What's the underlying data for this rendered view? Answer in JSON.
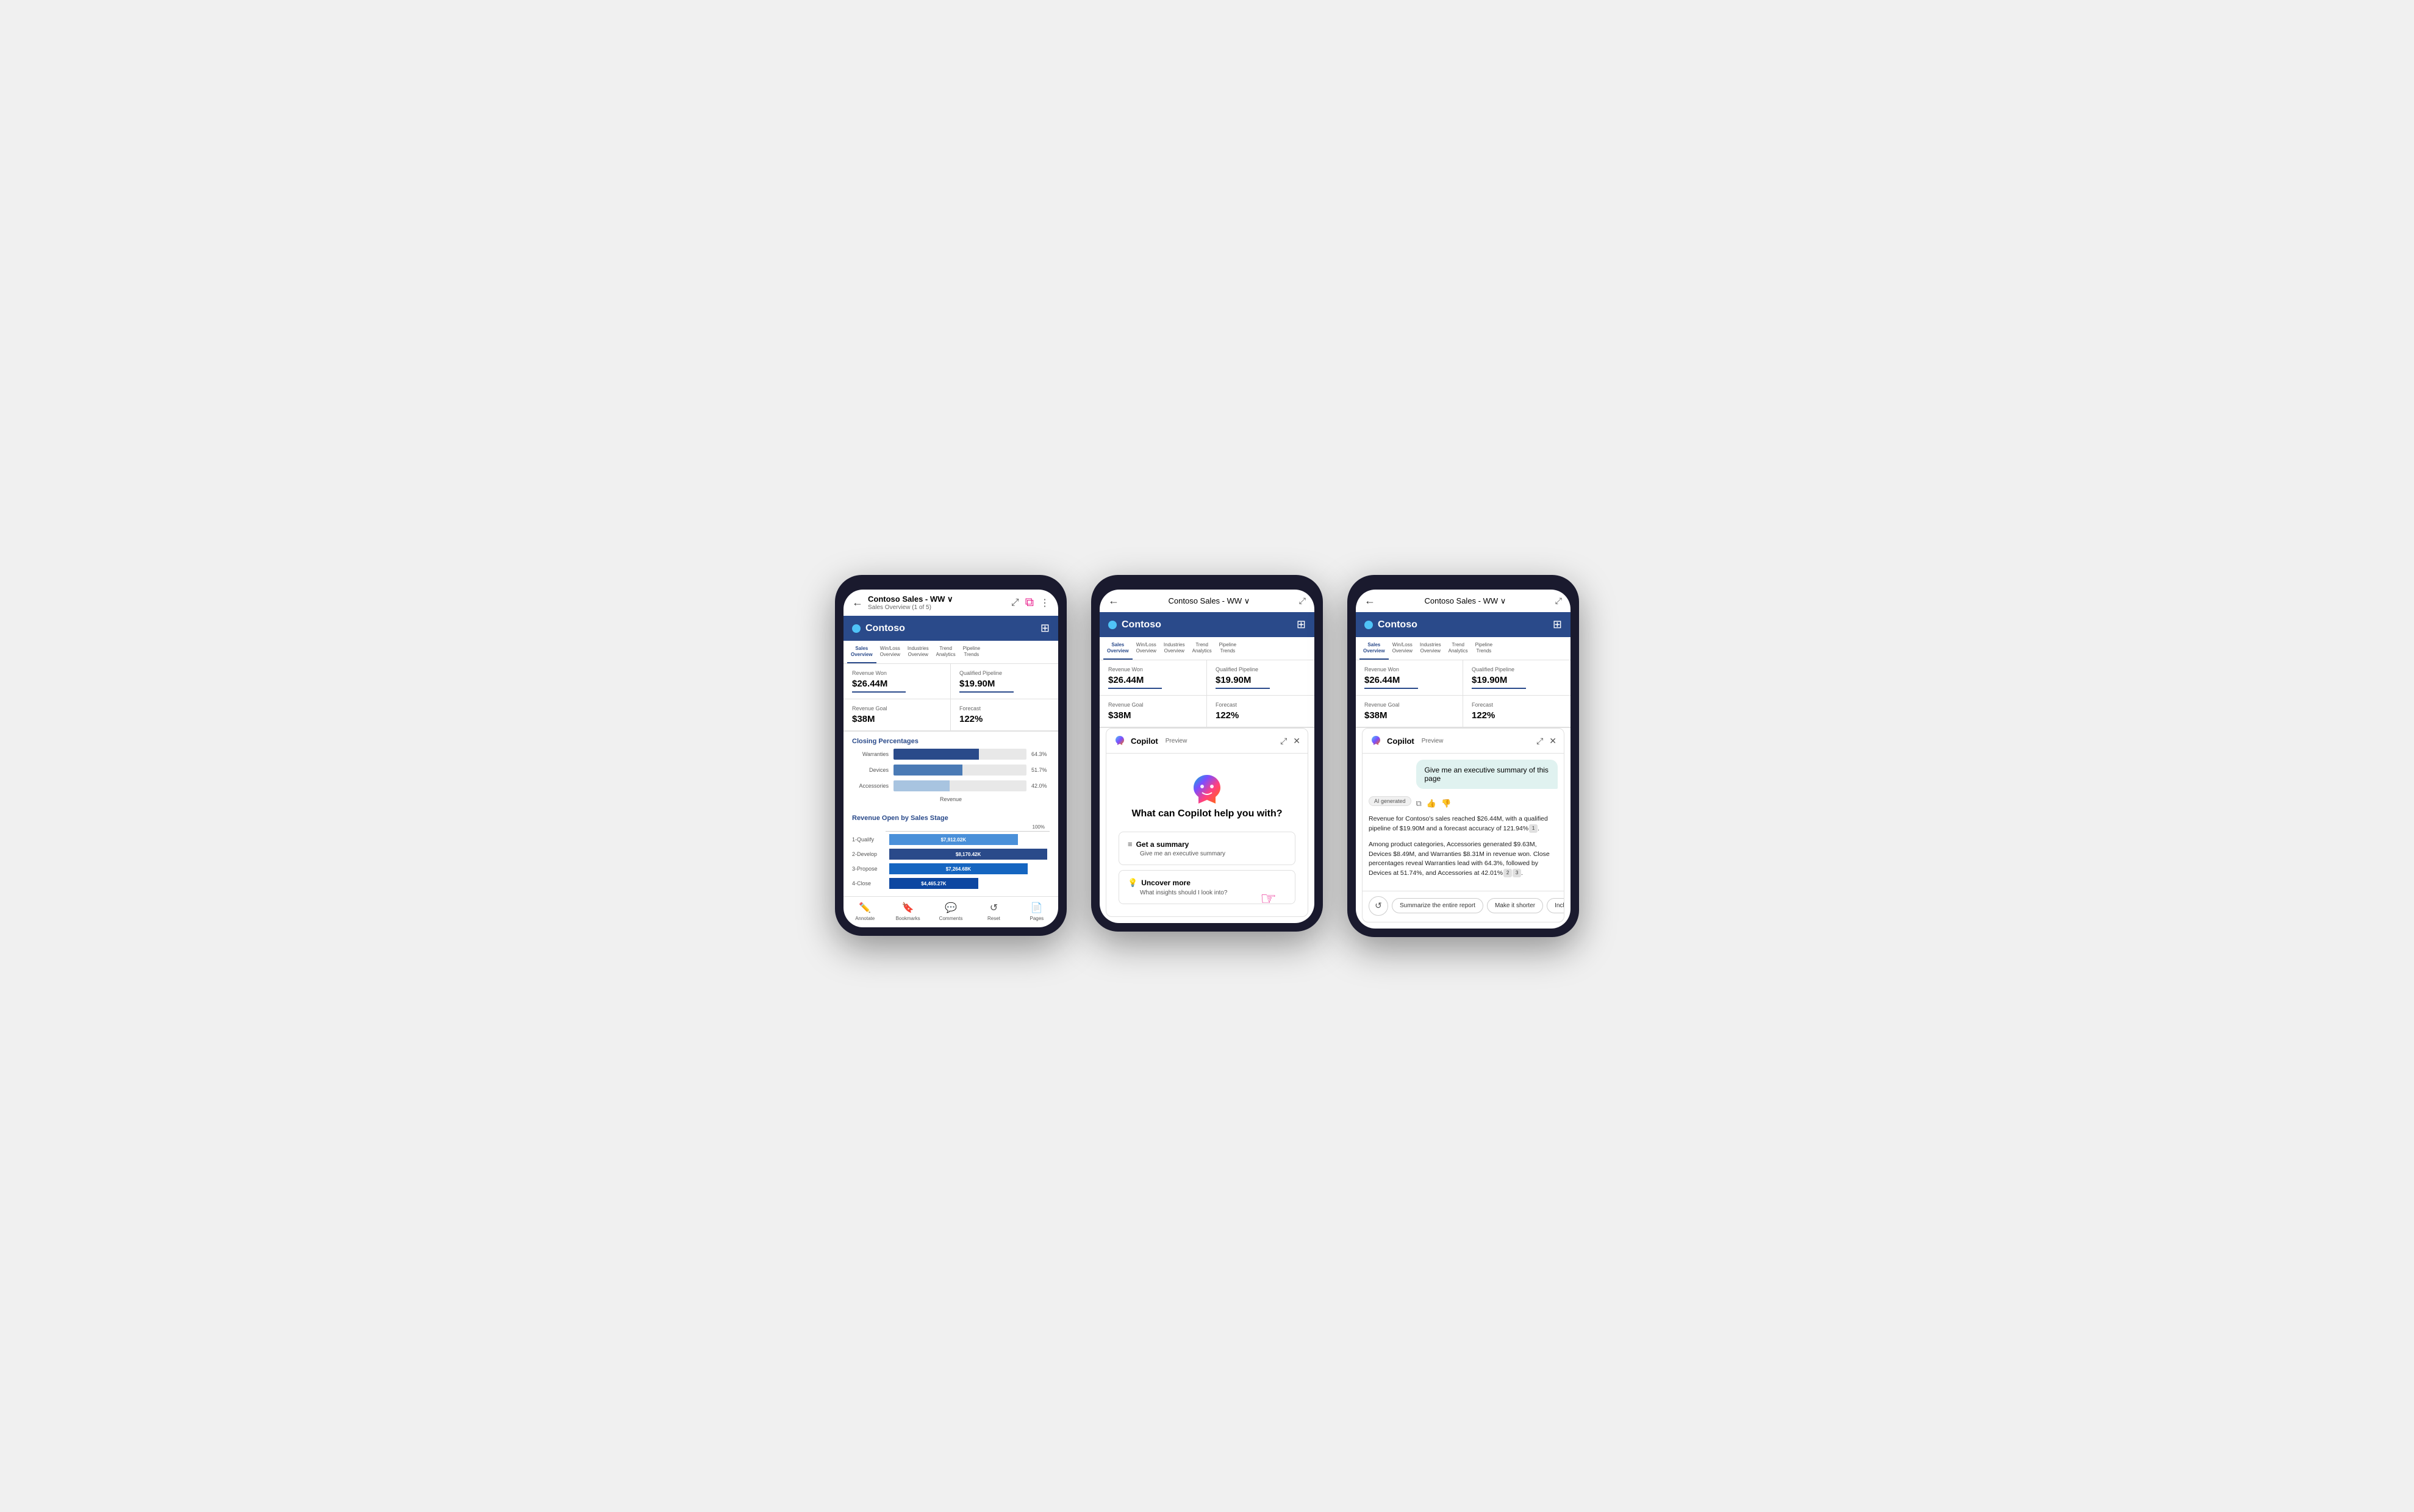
{
  "phone1": {
    "header": {
      "back": "←",
      "title": "Contoso Sales - WW",
      "subtitle": "Sales Overview (1 of 5)",
      "chevron": "∨"
    },
    "contoso": {
      "name": "Contoso",
      "filter_icon": "⊞"
    },
    "tabs": [
      {
        "label": "Sales\nOverview",
        "active": true
      },
      {
        "label": "Win/Loss\nOverview",
        "active": false
      },
      {
        "label": "Industries\nOverview",
        "active": false
      },
      {
        "label": "Trend\nAnalytics",
        "active": false
      },
      {
        "label": "Pipeline\nTrends",
        "active": false
      }
    ],
    "metrics": [
      {
        "label": "Revenue Won",
        "value": "$26.44M"
      },
      {
        "label": "Qualified Pipeline",
        "value": "$19.90M"
      },
      {
        "label": "Revenue Goal",
        "value": "$38M"
      },
      {
        "label": "Forecast",
        "value": "122%"
      }
    ],
    "closing": {
      "title": "Closing Percentages",
      "bars": [
        {
          "label": "Warranties",
          "pct": 64.3,
          "display": "64.3%",
          "style": "dark"
        },
        {
          "label": "Devices",
          "pct": 51.7,
          "display": "51.7%",
          "style": "medium"
        },
        {
          "label": "Accessories",
          "pct": 42.0,
          "display": "42.0%",
          "style": "light"
        }
      ],
      "x_label": "Revenue"
    },
    "revenue_stage": {
      "title": "Revenue Open by Sales Stage",
      "pct_label": "100%",
      "rows": [
        {
          "label": "1-Qualify",
          "value": "$7,912.02K",
          "width": 65
        },
        {
          "label": "2-Develop",
          "value": "$8,170.42K",
          "width": 80
        },
        {
          "label": "3-Propose",
          "value": "$7,264.68K",
          "width": 70
        },
        {
          "label": "4-Close",
          "value": "$4,465.27K",
          "width": 45
        }
      ]
    },
    "bottom_nav": [
      {
        "icon": "✏️",
        "label": "Annotate"
      },
      {
        "icon": "🔖",
        "label": "Bookmarks"
      },
      {
        "icon": "💬",
        "label": "Comments"
      },
      {
        "icon": "↺",
        "label": "Reset"
      },
      {
        "icon": "📄",
        "label": "Pages"
      }
    ]
  },
  "phone2": {
    "header": {
      "back": "←",
      "title": "Contoso Sales - WW",
      "chevron": "∨",
      "expand": "⤢"
    },
    "contoso": {
      "name": "Contoso"
    },
    "tabs": [
      {
        "label": "Sales\nOverview",
        "active": true
      },
      {
        "label": "Win/Loss\nOverview",
        "active": false
      },
      {
        "label": "Industries\nOverview",
        "active": false
      },
      {
        "label": "Trend\nAnalytics",
        "active": false
      },
      {
        "label": "Pipeline\nTrends",
        "active": false
      }
    ],
    "metrics": [
      {
        "label": "Revenue Won",
        "value": "$26.44M"
      },
      {
        "label": "Qualified Pipeline",
        "value": "$19.90M"
      },
      {
        "label": "Revenue Goal",
        "value": "$38M"
      },
      {
        "label": "Forecast",
        "value": "122%"
      }
    ],
    "copilot": {
      "title": "Copilot",
      "preview": "Preview",
      "question": "What can Copilot help you with?",
      "suggestions": [
        {
          "icon": "≡",
          "title": "Get a summary",
          "subtitle": "Give me an executive summary",
          "icon_type": "list"
        },
        {
          "icon": "💡",
          "title": "Uncover more",
          "subtitle": "What insights should I look into?",
          "icon_type": "bulb"
        }
      ]
    }
  },
  "phone3": {
    "header": {
      "back": "←",
      "title": "Contoso Sales - WW",
      "chevron": "∨",
      "expand": "⤢"
    },
    "contoso": {
      "name": "Contoso"
    },
    "tabs": [
      {
        "label": "Sales\nOverview",
        "active": true
      },
      {
        "label": "Win/Loss\nOverview",
        "active": false
      },
      {
        "label": "Industries\nOverview",
        "active": false
      },
      {
        "label": "Trend\nAnalytics",
        "active": false
      },
      {
        "label": "Pipeline\nTrends",
        "active": false
      }
    ],
    "metrics": [
      {
        "label": "Revenue Won",
        "value": "$26.44M"
      },
      {
        "label": "Qualified Pipeline",
        "value": "$19.90M"
      },
      {
        "label": "Revenue Goal",
        "value": "$38M"
      },
      {
        "label": "Forecast",
        "value": "122%"
      }
    ],
    "copilot": {
      "title": "Copilot",
      "preview": "Preview",
      "user_message": "Give me an executive summary of this page",
      "ai_badge": "AI generated",
      "response_p1": "Revenue for Contoso's sales reached $26.44M, with a qualified pipeline of $19.90M and a forecast accuracy of 121.94%",
      "ref1": "1",
      "response_p2": "Among product categories, Accessories generated $9.63M, Devices $8.49M, and Warranties $8.31M in revenue won. Close percentages reveal Warranties lead with 64.3%, followed by Devices at 51.74%, and Accessories at 42.01%",
      "ref2": "2",
      "ref3": "3",
      "actions": [
        "Summarize the entire report",
        "Make it shorter",
        "Include more details"
      ]
    }
  }
}
